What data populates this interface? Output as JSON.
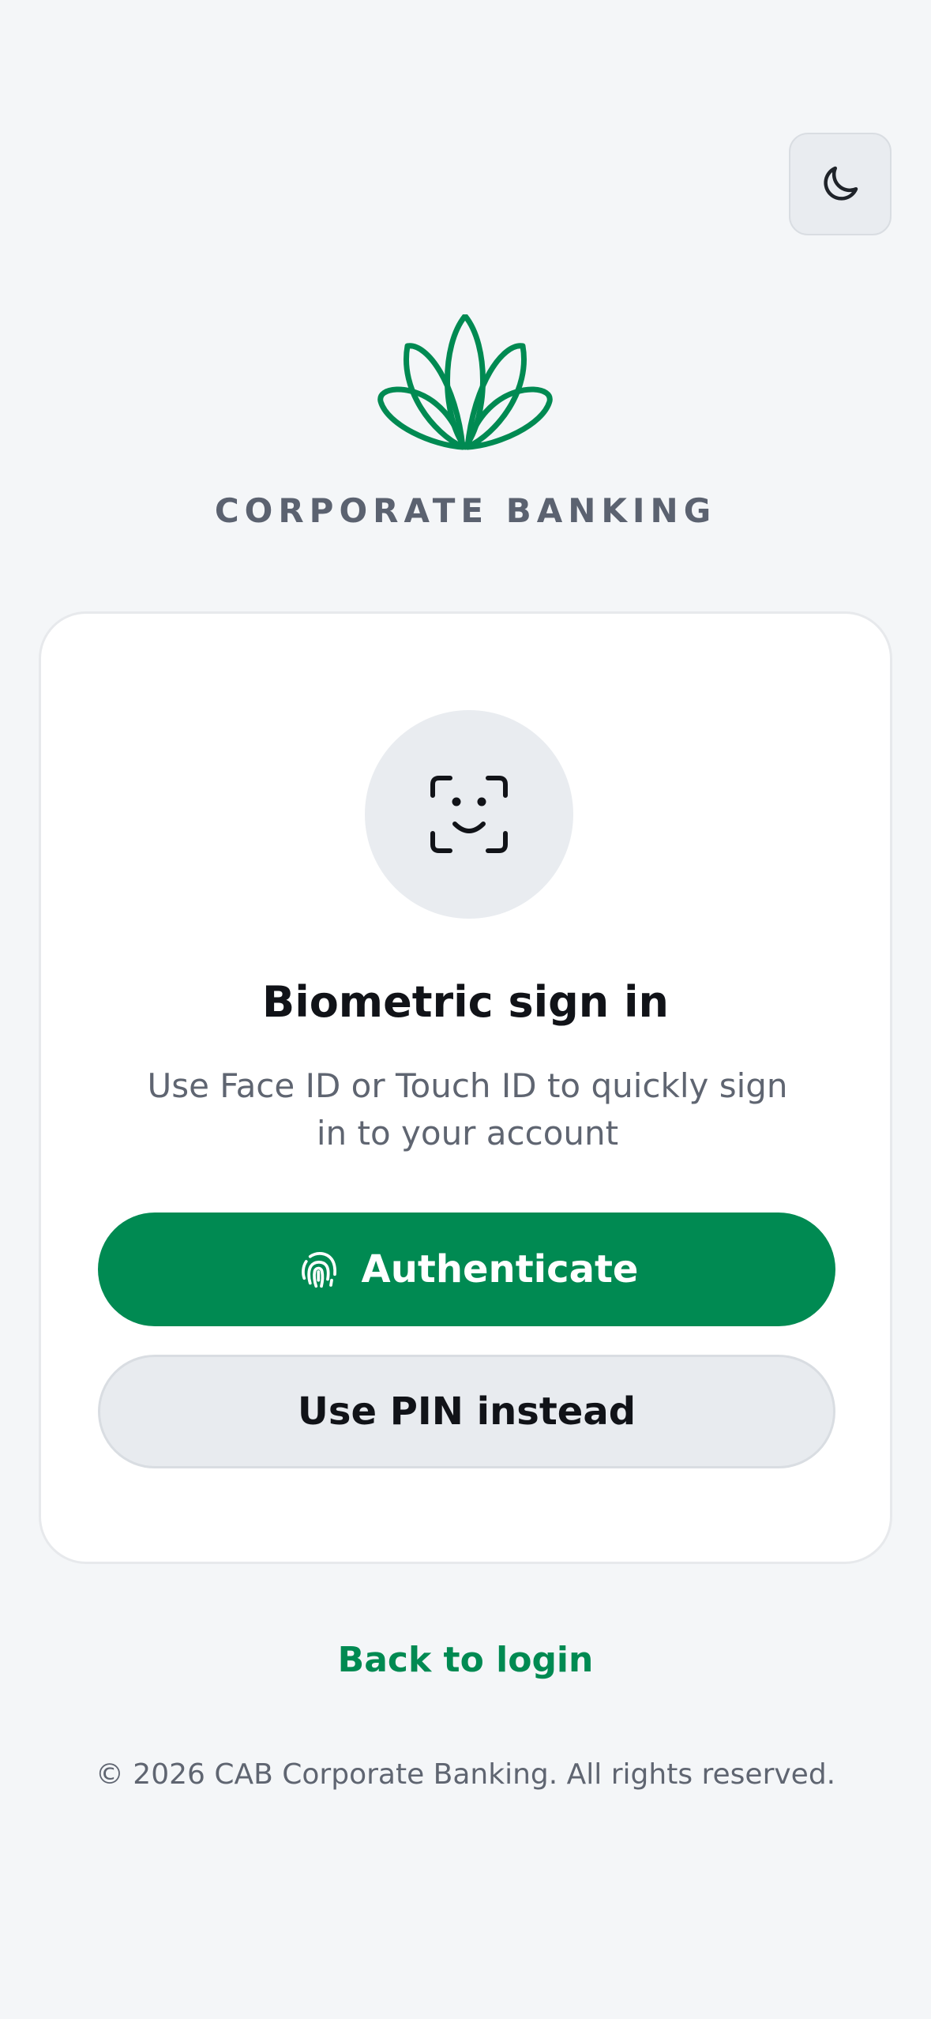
{
  "theme_toggle": {
    "icon": "moon-icon"
  },
  "brand": {
    "name": "CORPORATE BANKING",
    "color": "#008a52"
  },
  "card": {
    "icon": "face-id-icon",
    "title": "Biometric sign in",
    "subtitle": "Use Face ID or Touch ID to quickly sign in to your account",
    "authenticate_label": "Authenticate",
    "authenticate_icon": "fingerprint-icon",
    "pin_label": "Use PIN instead"
  },
  "back_link": "Back to login",
  "footer": "© 2026 CAB Corporate Banking. All rights reserved."
}
